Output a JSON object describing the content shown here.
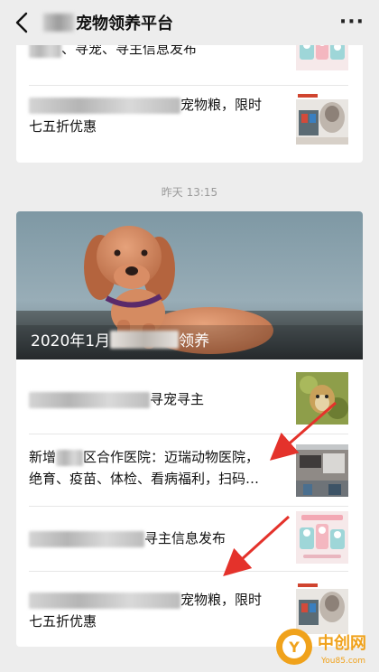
{
  "header": {
    "title": "宠物领养平台",
    "more_icon": "more-icon",
    "back_icon": "back-arrow-icon"
  },
  "card_top": {
    "row1_text": "、寻宠、寻主信息发布",
    "row2_text_a": "宠物粮，限时",
    "row2_text_b": "七五折优惠"
  },
  "timestamp": "昨天 13:15",
  "card_main": {
    "hero_caption_a": "2020年1月",
    "hero_caption_b": "领养",
    "row1_text": "寻宠寻主",
    "row2_text_a": "新增",
    "row2_text_b": "区合作医院：迈瑞动物医院，",
    "row2_text_c": "绝育、疫苗、体检、看病福利，扫码…",
    "row3_text": "寻主信息发布",
    "row4_text_a": "宠物粮，限时",
    "row4_text_b": "七五折优惠"
  },
  "watermark": {
    "brand": "中创网",
    "url": "You85.com"
  },
  "colors": {
    "background": "#ededed",
    "arrow": "#e4322b",
    "watermark_orange": "#f0a21b"
  }
}
